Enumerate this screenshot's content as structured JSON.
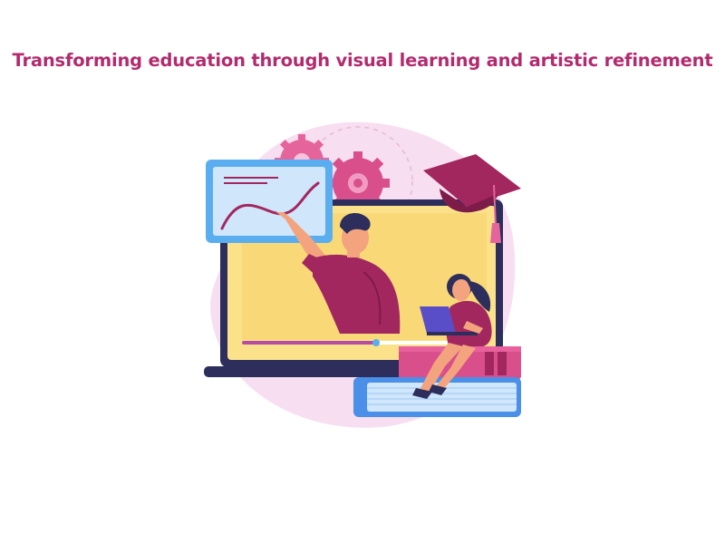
{
  "headline": {
    "text": "Transforming education through visual learning and artistic refinement",
    "color": "#b32b6e"
  },
  "illustration": {
    "subject": "online-education-illustration",
    "colors": {
      "blob": "#f7def0",
      "laptop_screen": "#fbe28a",
      "laptop_body": "#2d2e5c",
      "whiteboard": "#cfe6fb",
      "whiteboard_frame": "#5aaef0",
      "accent_magenta": "#a3275f",
      "book_blue": "#4a8fe8",
      "book_pink": "#d94f8c",
      "gear": "#e4649b"
    }
  }
}
